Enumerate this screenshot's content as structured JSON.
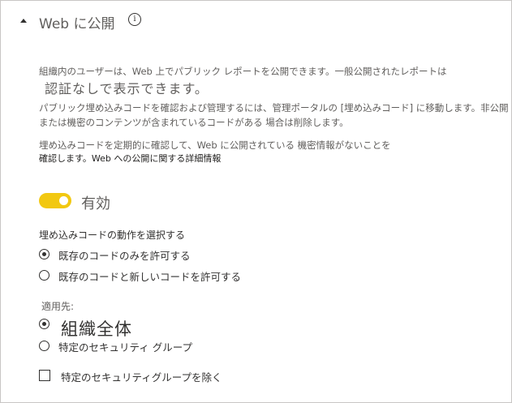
{
  "header": {
    "title": "Web に公開",
    "info_glyph": "i",
    "collapse_icon": "collapse-triangle-icon"
  },
  "description": {
    "line1": "組織内のユーザーは、Web 上でパブリック レポートを公開できます。一般公開されたレポートは",
    "line2": "認証なしで表示できます。",
    "line3": "パブリック埋め込みコードを確認および管理するには、管理ポータルの [埋め込みコード] に移動します。非公開",
    "line4": "または機密のコンテンツが含まれているコードがある 場合は削除します。",
    "line5": "埋め込みコードを定期的に確認して、Web に公開されている 機密情報がないことを",
    "line6": "確認します。Web への公開に関する詳細情報"
  },
  "toggle": {
    "label": "有効",
    "state": "on",
    "color": "#f2c811"
  },
  "embed_behavior": {
    "label": "埋め込みコードの動作を選択する",
    "options": [
      {
        "label": "既存のコードのみを許可する",
        "selected": true
      },
      {
        "label": "既存のコードと新しいコードを許可する",
        "selected": false
      }
    ]
  },
  "apply_to": {
    "label": "適用先:",
    "options": [
      {
        "label": "組織全体",
        "selected": true
      },
      {
        "label": "特定のセキュリティ グループ",
        "selected": false
      }
    ]
  },
  "exclude": {
    "label": "特定のセキュリティグループを除く",
    "checked": false
  }
}
